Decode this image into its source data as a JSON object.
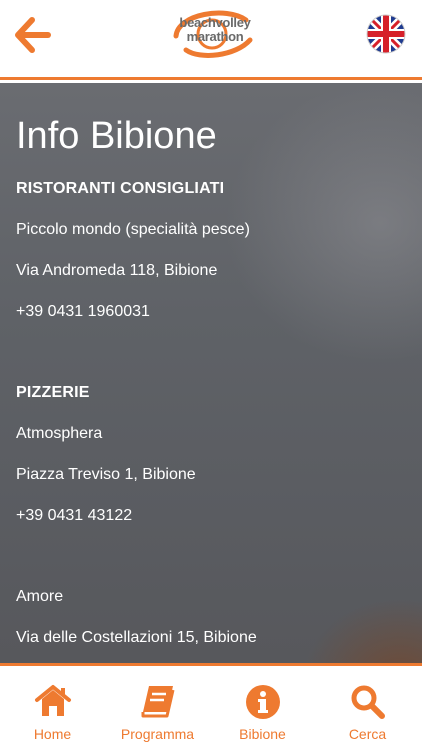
{
  "header": {
    "logo_line1": "beachvolley",
    "logo_line2": "marathon",
    "back_icon": "arrow-left-icon",
    "language_icon": "uk-flag-icon"
  },
  "colors": {
    "accent": "#ee7a30"
  },
  "content": {
    "title": "Info Bibione",
    "sections": [
      {
        "heading": "RISTORANTI CONSIGLIATI",
        "lines": [
          "Piccolo mondo (specialità pesce)",
          "Via Andromeda 118, Bibione",
          "+39 0431 1960031"
        ]
      },
      {
        "heading": "PIZZERIE",
        "lines": [
          "Atmosphera",
          "Piazza Treviso 1, Bibione",
          "+39 0431 43122",
          "Amore",
          "Via delle Costellazioni 15, Bibione"
        ]
      }
    ]
  },
  "nav": {
    "items": [
      {
        "label": "Home",
        "icon": "home-icon"
      },
      {
        "label": "Programma",
        "icon": "book-icon"
      },
      {
        "label": "Bibione",
        "icon": "info-icon"
      },
      {
        "label": "Cerca",
        "icon": "search-icon"
      }
    ]
  }
}
